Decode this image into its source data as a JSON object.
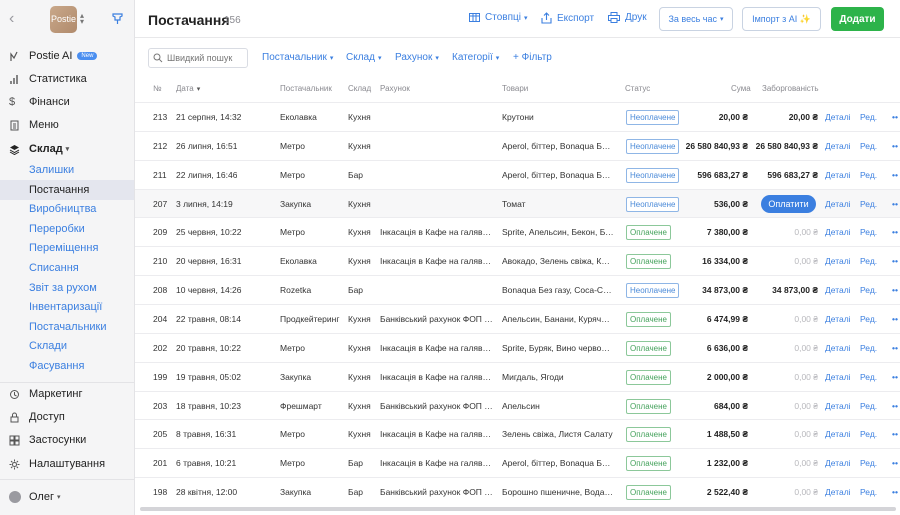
{
  "sidebar": {
    "logo_text": "Postie",
    "items": {
      "ai": {
        "label": "Postie AI",
        "badge": "New"
      },
      "stats": {
        "label": "Статистика"
      },
      "finance": {
        "label": "Фінанси"
      },
      "menu": {
        "label": "Меню"
      },
      "warehouse": {
        "label": "Склад"
      },
      "marketing": {
        "label": "Маркетинг"
      },
      "access": {
        "label": "Доступ"
      },
      "apps": {
        "label": "Застосунки"
      },
      "settings": {
        "label": "Налаштування"
      }
    },
    "sub_items": [
      "Залишки",
      "Постачання",
      "Виробництва",
      "Переробки",
      "Переміщення",
      "Списання",
      "Звіт за рухом",
      "Інвентаризації",
      "Постачальники",
      "Склади",
      "Фасування"
    ],
    "user": "Олег"
  },
  "header": {
    "title": "Постачання",
    "count": "156",
    "columns_btn": "Стовпці",
    "export_btn": "Експорт",
    "print_btn": "Друк",
    "period_btn": "За весь час",
    "import_btn": "Імпорт з AI ✨",
    "add_btn": "Додати"
  },
  "filters": {
    "search_placeholder": "Швидкий пошук",
    "supplier": "Постачальник",
    "warehouse": "Склад",
    "account": "Рахунок",
    "category": "Категорії",
    "add_filter": "+ Фільтр"
  },
  "table": {
    "headers": {
      "num": "№",
      "date": "Дата",
      "supplier": "Постачальник",
      "warehouse": "Склад",
      "account": "Рахунок",
      "goods": "Товари",
      "status": "Статус",
      "sum": "Сума",
      "debt": "Заборгованість"
    },
    "action_details": "Деталі",
    "action_edit": "Ред.",
    "action_pay": "Оплатити",
    "rows": [
      {
        "num": "213",
        "date": "21 серпня, 14:32",
        "supplier": "Еколавка",
        "warehouse": "Кухня",
        "account": "",
        "goods": "Крутони",
        "status": "Неоплачене",
        "paid": false,
        "sum": "20,00 ₴",
        "debt": "20,00 ₴"
      },
      {
        "num": "212",
        "date": "26 липня, 16:51",
        "supplier": "Метро",
        "warehouse": "Кухня",
        "account": "",
        "goods": "Aperol, біттер, Bonaqua Без газу",
        "status": "Неоплачене",
        "paid": false,
        "sum": "26 580 840,93 ₴",
        "debt": "26 580 840,93 ₴"
      },
      {
        "num": "211",
        "date": "22 липня, 16:46",
        "supplier": "Метро",
        "warehouse": "Бар",
        "account": "",
        "goods": "Aperol, біттер, Bonaqua Без газу",
        "status": "Неоплачене",
        "paid": false,
        "sum": "596 683,27 ₴",
        "debt": "596 683,27 ₴"
      },
      {
        "num": "207",
        "date": "3 липня, 14:19",
        "supplier": "Закупка",
        "warehouse": "Кухня",
        "account": "",
        "goods": "Томат",
        "status": "Неоплачене",
        "paid": false,
        "sum": "536,00 ₴",
        "debt": "",
        "pay_button": true
      },
      {
        "num": "209",
        "date": "25 червня, 10:22",
        "supplier": "Метро",
        "warehouse": "Кухня",
        "account": "Інкасація в Кафе на галявинці",
        "goods": "Sprite, Апельсин, Бекон, Буряк",
        "status": "Оплачене",
        "paid": true,
        "sum": "7 380,00 ₴",
        "debt": "0,00 ₴"
      },
      {
        "num": "210",
        "date": "20 червня, 16:31",
        "supplier": "Еколавка",
        "warehouse": "Кухня",
        "account": "Інкасація в Кафе на галявинці",
        "goods": "Авокадо, Зелень свіжа, Капуста",
        "status": "Оплачене",
        "paid": true,
        "sum": "16 334,00 ₴",
        "debt": "0,00 ₴"
      },
      {
        "num": "208",
        "date": "10 червня, 14:26",
        "supplier": "Rozetka",
        "warehouse": "Бар",
        "account": "",
        "goods": "Bonaqua Без газу, Coca-Cola",
        "status": "Неоплачене",
        "paid": false,
        "sum": "34 873,00 ₴",
        "debt": "34 873,00 ₴"
      },
      {
        "num": "204",
        "date": "22 травня, 08:14",
        "supplier": "Продкейтеринг",
        "warehouse": "Кухня",
        "account": "Банківський рахунок ФОП Петренко",
        "goods": "Апельсин, Банани, Куряче філе",
        "status": "Оплачене",
        "paid": true,
        "sum": "6 474,99 ₴",
        "debt": "0,00 ₴"
      },
      {
        "num": "202",
        "date": "20 травня, 10:22",
        "supplier": "Метро",
        "warehouse": "Кухня",
        "account": "Інкасація в Кафе на галявинці",
        "goods": "Sprite, Буряк, Вино червоне сухе",
        "status": "Оплачене",
        "paid": true,
        "sum": "6 636,00 ₴",
        "debt": "0,00 ₴"
      },
      {
        "num": "199",
        "date": "19 травня, 05:02",
        "supplier": "Закупка",
        "warehouse": "Кухня",
        "account": "Інкасація в Кафе на галявинці",
        "goods": "Мигдаль, Ягоди",
        "status": "Оплачене",
        "paid": true,
        "sum": "2 000,00 ₴",
        "debt": "0,00 ₴"
      },
      {
        "num": "203",
        "date": "18 травня, 10:23",
        "supplier": "Фрешмарт",
        "warehouse": "Кухня",
        "account": "Банківський рахунок ФОП Петренко",
        "goods": "Апельсин",
        "status": "Оплачене",
        "paid": true,
        "sum": "684,00 ₴",
        "debt": "0,00 ₴"
      },
      {
        "num": "205",
        "date": "8 травня, 16:31",
        "supplier": "Метро",
        "warehouse": "Кухня",
        "account": "Інкасація в Кафе на галявинці",
        "goods": "Зелень свіжа, Листя Салату",
        "status": "Оплачене",
        "paid": true,
        "sum": "1 488,50 ₴",
        "debt": "0,00 ₴"
      },
      {
        "num": "201",
        "date": "6 травня, 10:21",
        "supplier": "Метро",
        "warehouse": "Бар",
        "account": "Інкасація в Кафе на галявинці",
        "goods": "Aperol, біттер, Bonaqua Без газу",
        "status": "Оплачене",
        "paid": true,
        "sum": "1 232,00 ₴",
        "debt": "0,00 ₴"
      },
      {
        "num": "198",
        "date": "28 квітня, 12:00",
        "supplier": "Закупка",
        "warehouse": "Бар",
        "account": "Банківський рахунок ФОП Петренко",
        "goods": "Борошно пшеничне, Вода, Цукор",
        "status": "Оплачене",
        "paid": true,
        "sum": "2 522,40 ₴",
        "debt": "0,00 ₴"
      }
    ]
  },
  "colors": {
    "accent": "#3b7fe0",
    "add_button": "#2db34a",
    "paid": "#45a25c",
    "unpaid": "#4a8ad8"
  }
}
